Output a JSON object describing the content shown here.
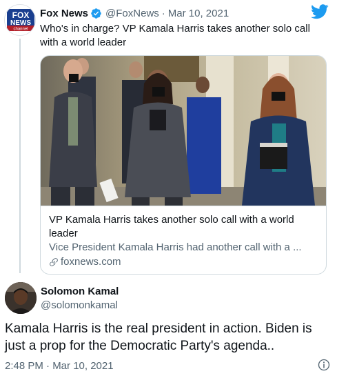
{
  "quoted_tweet": {
    "avatar": {
      "line1": "FOX",
      "line2": "NEWS",
      "line3": "channel"
    },
    "name": "Fox News",
    "handle": "@FoxNews",
    "separator": "·",
    "date": "Mar 10, 2021",
    "text": "Who's in charge? VP Kamala Harris takes another solo call with a world leader",
    "card": {
      "title": "VP Kamala Harris takes another solo call with a world leader",
      "description": "Vice President Kamala Harris had another call with a ...",
      "domain": "foxnews.com"
    }
  },
  "tweet": {
    "name": "Solomon Kamal",
    "handle": "@solomonkamal",
    "text": "Kamala Harris is the real president in action. Biden is just a prop for the Democratic Party's agenda..",
    "timestamp": "2:48 PM · Mar 10, 2021"
  },
  "icons": {
    "verified": "verified-badge-icon",
    "brand": "twitter-bird-icon",
    "link": "link-icon",
    "info": "info-icon"
  },
  "colors": {
    "twitter_blue": "#1d9bf0",
    "text": "#0f1419",
    "secondary_text": "#536471",
    "border": "#cfd9de"
  }
}
